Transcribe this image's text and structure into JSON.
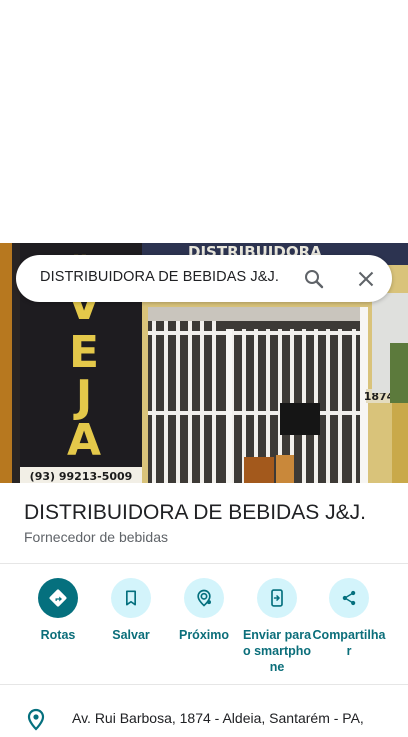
{
  "search": {
    "query": "DISTRIBUIDORA DE BEBIDAS J&J.",
    "search_icon": "search-icon",
    "close_icon": "close-icon"
  },
  "photo": {
    "sign_text": "DISTRIBUIDORA",
    "banner_text": "VEJA",
    "phone_text": "(93) 99213-5009",
    "house_number": "1874"
  },
  "place": {
    "title": "DISTRIBUIDORA DE BEBIDAS J&J.",
    "category": "Fornecedor de bebidas"
  },
  "actions": [
    {
      "label": "Rotas",
      "icon": "directions-icon"
    },
    {
      "label": "Salvar",
      "icon": "bookmark-icon"
    },
    {
      "label": "Próximo",
      "icon": "nearby-icon"
    },
    {
      "label": "Enviar para o smartphone",
      "icon": "send-to-phone-icon"
    },
    {
      "label": "Compartilhar",
      "icon": "share-icon"
    }
  ],
  "address": {
    "text": "Av. Rui Barbosa, 1874 - Aldeia, Santarém - PA,",
    "icon": "location-pin-icon"
  },
  "colors": {
    "accent": "#05707e",
    "accent_light": "#d3f4fb",
    "action_text": "#0b6e7a"
  }
}
